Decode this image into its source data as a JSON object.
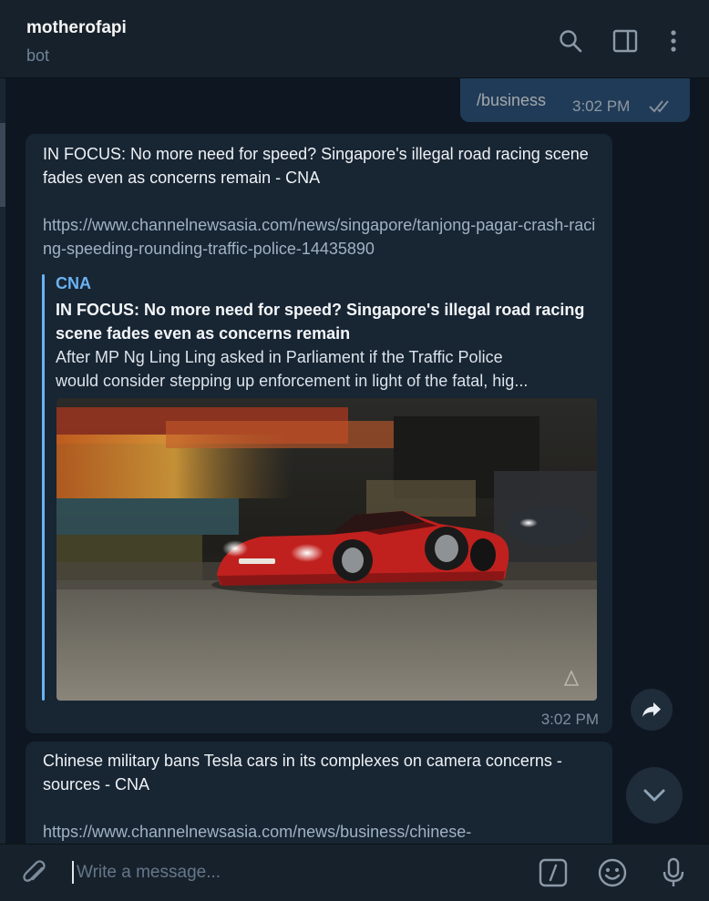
{
  "header": {
    "chat_name": "motherofapi",
    "chat_status": "bot",
    "icons": [
      "search-icon",
      "sidebar-toggle-icon",
      "more-vertical-icon"
    ]
  },
  "outgoing": {
    "text": "/business",
    "time": "3:02 PM",
    "status": "read"
  },
  "messages": [
    {
      "text": "IN FOCUS: No more need for speed? Singapore's illegal road racing scene fades even as concerns remain - CNA",
      "link": "https://www.channelnewsasia.com/news/singapore/tanjong-pagar-crash-racing-speeding-rounding-traffic-police-14435890",
      "preview": {
        "site": "CNA",
        "title": "IN FOCUS: No more need for speed? Singapore's illegal road racing scene fades even as concerns remain",
        "description_line1": "After MP Ng Ling Ling asked in Parliament if the Traffic Police",
        "description_line2": "would consider stepping up enforcement in light of the fatal, hig..."
      },
      "time": "3:02 PM"
    },
    {
      "text": "Chinese military bans Tesla cars in its complexes on camera concerns - sources - CNA",
      "link": "https://www.channelnewsasia.com/news/business/chinese-"
    }
  ],
  "input": {
    "placeholder": "Write a message..."
  },
  "colors": {
    "background": "#0e1621",
    "header": "#17212b",
    "bubble_in": "#182533",
    "bubble_out": "#2b5278",
    "accent": "#6ab3f3"
  }
}
